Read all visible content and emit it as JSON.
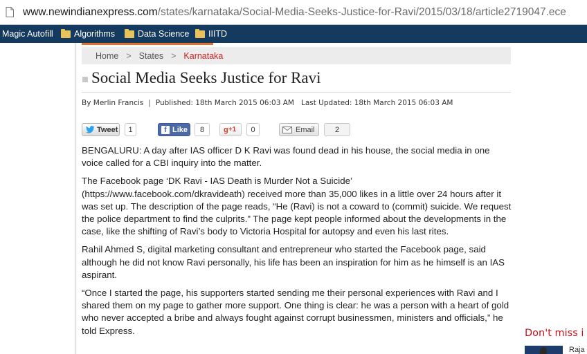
{
  "browser": {
    "url_host": "www.newindianexpress.com",
    "url_path": "/states/karnataka/Social-Media-Seeks-Justice-for-Ravi/2015/03/18/article2719047.ece",
    "bookmarks": [
      {
        "label": "Magic Autofill",
        "icon": "none"
      },
      {
        "label": "Algorithms",
        "icon": "folder-icon"
      },
      {
        "label": "Data Science",
        "icon": "folder-icon"
      },
      {
        "label": "IIITD",
        "icon": "folder-icon"
      }
    ],
    "accent_color": "#143a5f"
  },
  "breadcrumb": {
    "items": [
      "Home",
      "States",
      "Karnataka"
    ],
    "separator": ">",
    "current_color": "#cc1f1f"
  },
  "article": {
    "title": "Social Media Seeks Justice for Ravi",
    "byline": {
      "author": "By Merlin Francis",
      "published": "Published: 18th March 2015 06:03 AM",
      "updated": "Last Updated: 18th March 2015 06:03 AM",
      "separator": "|"
    },
    "paragraphs": [
      "BENGALURU: A day after IAS officer D K Ravi was found dead in his house, the social media in one voice called for a CBI inquiry into the matter.",
      "The Facebook page ‘DK Ravi - IAS Death is Murder Not a Suicide’ (https://www.facebook.com/dkravideath) received more than 35,000 likes in a little over 24 hours after it was set up. The description of the page reads, “He (Ravi) is not a coward to (commit) suicide. We request the police department to find the culprits.” The page kept people informed about the developments in the case, like the shifting of Ravi’s body to Victoria Hospital for autopsy and even his last rites.",
      "Rahil Ahmed S, digital marketing consultant and entrepreneur who started the Facebook page, said although he did not know Ravi personally, his life has been an inspiration for him as he himself is an IAS aspirant.",
      "“Once I started the page, his supporters started sending me their personal experiences with Ravi and I shared them on my page to gather more support. One thing is clear: he was a person with a heart of gold who never accepted a bribe and always fought against corrupt businessmen, ministers and officials,” he told Express."
    ]
  },
  "social": {
    "tweet": {
      "label": "Tweet",
      "count": "1"
    },
    "like": {
      "label": "Like",
      "count": "8"
    },
    "gplus": {
      "label": "+1",
      "count": "0"
    },
    "email": {
      "label": "Email",
      "count": "2"
    }
  },
  "sidebar": {
    "dont_miss": "Don't miss i",
    "item_name": "Raja"
  }
}
